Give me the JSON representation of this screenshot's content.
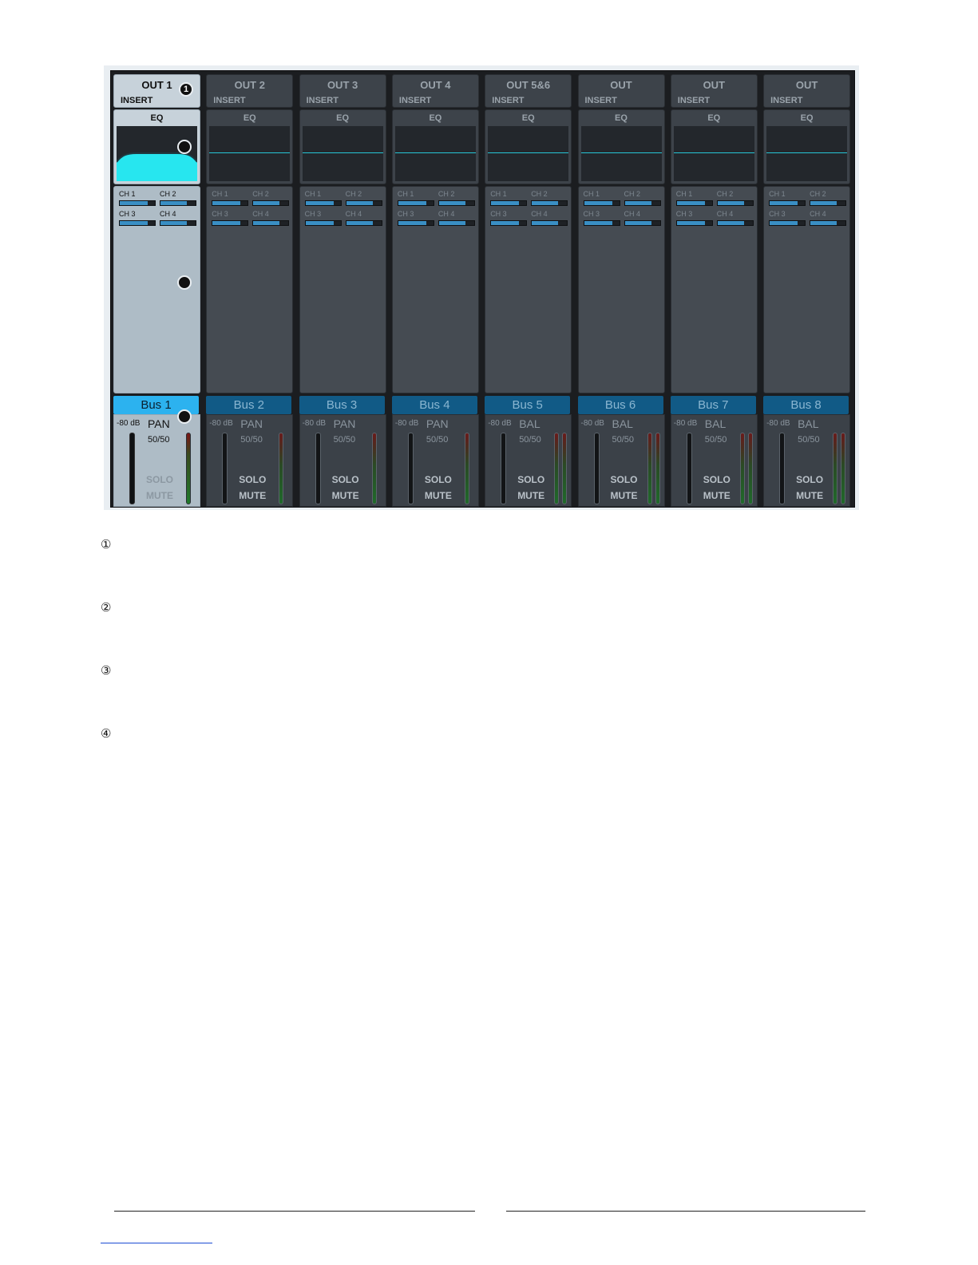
{
  "colors": {
    "bus_active": "#2cb2ef",
    "bus_inactive": "#115a86",
    "eq_curve": "#27c6d6",
    "send_fill": "#3a8fc4"
  },
  "strips": [
    {
      "out": "OUT 1",
      "insert": "INSERT",
      "eq": "EQ",
      "bus": "Bus 1",
      "db": "-80 dB",
      "pan": "PAN",
      "ratio": "50/50",
      "solo": "SOLO",
      "mute": "MUTE",
      "active": true,
      "stereo": false,
      "sends": [
        {
          "label": "CH 1",
          "level": 0.8
        },
        {
          "label": "CH 2",
          "level": 0.75
        },
        {
          "label": "CH 3",
          "level": 0.8
        },
        {
          "label": "CH 4",
          "level": 0.75
        }
      ]
    },
    {
      "out": "OUT 2",
      "insert": "INSERT",
      "eq": "EQ",
      "bus": "Bus 2",
      "db": "-80 dB",
      "pan": "PAN",
      "ratio": "50/50",
      "solo": "SOLO",
      "mute": "MUTE",
      "active": false,
      "stereo": false,
      "sends": [
        {
          "label": "CH 1",
          "level": 0.8
        },
        {
          "label": "CH 2",
          "level": 0.75
        },
        {
          "label": "CH 3",
          "level": 0.8
        },
        {
          "label": "CH 4",
          "level": 0.75
        }
      ]
    },
    {
      "out": "OUT 3",
      "insert": "INSERT",
      "eq": "EQ",
      "bus": "Bus 3",
      "db": "-80 dB",
      "pan": "PAN",
      "ratio": "50/50",
      "solo": "SOLO",
      "mute": "MUTE",
      "active": false,
      "stereo": false,
      "sends": [
        {
          "label": "CH 1",
          "level": 0.8
        },
        {
          "label": "CH 2",
          "level": 0.75
        },
        {
          "label": "CH 3",
          "level": 0.8
        },
        {
          "label": "CH 4",
          "level": 0.75
        }
      ]
    },
    {
      "out": "OUT 4",
      "insert": "INSERT",
      "eq": "EQ",
      "bus": "Bus 4",
      "db": "-80 dB",
      "pan": "PAN",
      "ratio": "50/50",
      "solo": "SOLO",
      "mute": "MUTE",
      "active": false,
      "stereo": false,
      "sends": [
        {
          "label": "CH 1",
          "level": 0.8
        },
        {
          "label": "CH 2",
          "level": 0.75
        },
        {
          "label": "CH 3",
          "level": 0.8
        },
        {
          "label": "CH 4",
          "level": 0.75
        }
      ]
    },
    {
      "out": "OUT 5&6",
      "insert": "INSERT",
      "eq": "EQ",
      "bus": "Bus 5",
      "db": "-80 dB",
      "pan": "BAL",
      "ratio": "50/50",
      "solo": "SOLO",
      "mute": "MUTE",
      "active": false,
      "stereo": true,
      "sends": [
        {
          "label": "CH 1",
          "level": 0.8
        },
        {
          "label": "CH 2",
          "level": 0.75
        },
        {
          "label": "CH 3",
          "level": 0.8
        },
        {
          "label": "CH 4",
          "level": 0.75
        }
      ]
    },
    {
      "out": "OUT",
      "insert": "INSERT",
      "eq": "EQ",
      "bus": "Bus 6",
      "db": "-80 dB",
      "pan": "BAL",
      "ratio": "50/50",
      "solo": "SOLO",
      "mute": "MUTE",
      "active": false,
      "stereo": true,
      "sends": [
        {
          "label": "CH 1",
          "level": 0.8
        },
        {
          "label": "CH 2",
          "level": 0.75
        },
        {
          "label": "CH 3",
          "level": 0.8
        },
        {
          "label": "CH 4",
          "level": 0.75
        }
      ]
    },
    {
      "out": "OUT",
      "insert": "INSERT",
      "eq": "EQ",
      "bus": "Bus 7",
      "db": "-80 dB",
      "pan": "BAL",
      "ratio": "50/50",
      "solo": "SOLO",
      "mute": "MUTE",
      "active": false,
      "stereo": true,
      "sends": [
        {
          "label": "CH 1",
          "level": 0.8
        },
        {
          "label": "CH 2",
          "level": 0.75
        },
        {
          "label": "CH 3",
          "level": 0.8
        },
        {
          "label": "CH 4",
          "level": 0.75
        }
      ]
    },
    {
      "out": "OUT",
      "insert": "INSERT",
      "eq": "EQ",
      "bus": "Bus 8",
      "db": "-80 dB",
      "pan": "BAL",
      "ratio": "50/50",
      "solo": "SOLO",
      "mute": "MUTE",
      "active": false,
      "stereo": true,
      "sends": [
        {
          "label": "CH 1",
          "level": 0.8
        },
        {
          "label": "CH 2",
          "level": 0.75
        },
        {
          "label": "CH 3",
          "level": 0.8
        },
        {
          "label": "CH 4",
          "level": 0.75
        }
      ]
    }
  ],
  "markers": {
    "m1": "1"
  },
  "callouts": [
    "①",
    "②",
    "③",
    "④"
  ]
}
